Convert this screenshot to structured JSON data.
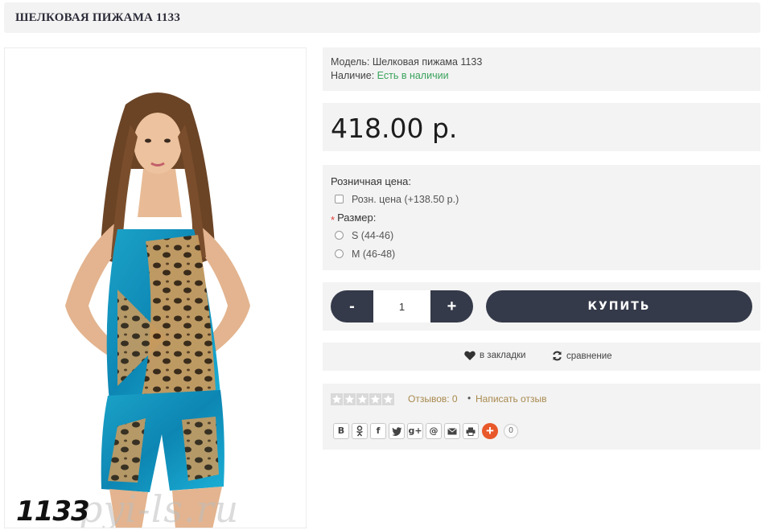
{
  "page_title": "ШЕЛКОВАЯ ПИЖАМА 1133",
  "product_image": {
    "label": "1133",
    "watermark": "pyi-ls.ru"
  },
  "info": {
    "model_label": "Модель:",
    "model_value": "Шелковая пижама 1133",
    "availability_label": "Наличие:",
    "availability_value": "Есть в наличии"
  },
  "price": "418.00 р.",
  "options": {
    "retail_label": "Розничная цена:",
    "retail_option": "Розн. цена (+138.50 р.)",
    "required_mark": "*",
    "size_label": "Размер:",
    "sizes": [
      "S (44-46)",
      "M (46-48)"
    ]
  },
  "buy": {
    "minus": "-",
    "quantity": "1",
    "plus": "+",
    "buy_label": "КУПИТЬ"
  },
  "links": {
    "bookmarks": "в закладки",
    "compare": "сравнение"
  },
  "reviews": {
    "rating": 0,
    "max_rating": 5,
    "count_label": "Отзывов: 0",
    "separator": "•",
    "write_label": "Написать отзыв"
  },
  "share": {
    "buttons": [
      "B",
      "ok",
      "f",
      "twitter",
      "g+",
      "@",
      "mail",
      "print"
    ],
    "plus": "+",
    "count": "0"
  },
  "colors": {
    "accent_dark": "#353a4a",
    "in_stock": "#3aa35c",
    "review_link": "#a8894e",
    "panel_bg": "#f3f3f3"
  }
}
